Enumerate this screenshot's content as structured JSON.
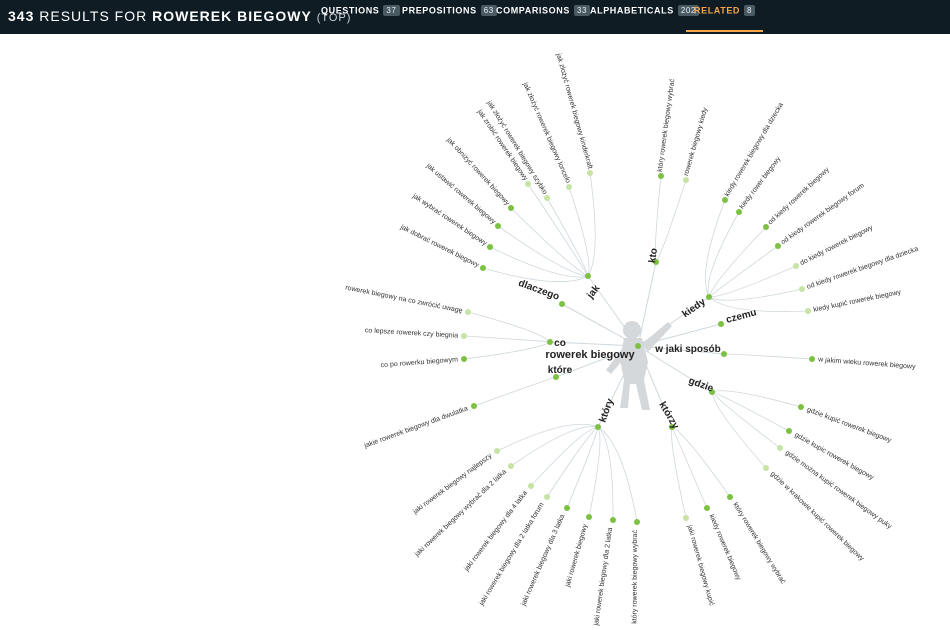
{
  "header": {
    "count": "343",
    "results_for": "RESULTS FOR",
    "keyword": "ROWEREK BIEGOWY",
    "mode": "(TOP)"
  },
  "tabs": [
    {
      "label": "QUESTIONS",
      "badge": "37",
      "active": false
    },
    {
      "label": "PREPOSITIONS",
      "badge": "63",
      "active": false
    },
    {
      "label": "COMPARISONS",
      "badge": "33",
      "active": false
    },
    {
      "label": "ALPHABETICALS",
      "badge": "202",
      "active": false
    },
    {
      "label": "RELATED",
      "badge": "8",
      "active": true
    }
  ],
  "colors": {
    "node_dark": "#7cc143",
    "node_light": "#c5e4a6",
    "link": "#cfd8dd",
    "header_bg": "#0f1c24",
    "active_tab": "#f3a64a"
  },
  "wheel": {
    "center_label": "rowerek biegowy",
    "center_icon": "person-silhouette-icon",
    "branches": [
      {
        "label": "jak",
        "leaves": [
          {
            "label": "jak dobrać rowerek biegowy",
            "shade": "dark"
          },
          {
            "label": "jak wybrać rowerek biegowy",
            "shade": "dark"
          },
          {
            "label": "jak ustawić rowerek biegowy",
            "shade": "dark"
          },
          {
            "label": "jak obniżyć rowerek biegowy",
            "shade": "dark"
          },
          {
            "label": "jak zrobić rowerek biegowy",
            "shade": "light"
          },
          {
            "label": "jak złożyć rowerek biegowy szybko",
            "shade": "light"
          },
          {
            "label": "jak złożyć rowerek biegowy loncelo",
            "shade": "light"
          },
          {
            "label": "jak złożyć rowerek biegowy kinderkraft",
            "shade": "light"
          }
        ]
      },
      {
        "label": "kto",
        "leaves": [
          {
            "label": "który rowerek biegowy wybrać",
            "shade": "dark"
          },
          {
            "label": "rowerek biegowy kiedy",
            "shade": "light"
          }
        ]
      },
      {
        "label": "kiedy",
        "leaves": [
          {
            "label": "kiedy rowerek biegowy dla dziecka",
            "shade": "dark"
          },
          {
            "label": "kiedy rower biegowy",
            "shade": "dark"
          },
          {
            "label": "od kiedy rowerek biegowy",
            "shade": "dark"
          },
          {
            "label": "od kiedy rowerek biegowy forum",
            "shade": "dark"
          },
          {
            "label": "do kiedy rowerek biegowy",
            "shade": "light"
          },
          {
            "label": "od kiedy rowerek biegowy dla dziecka",
            "shade": "light"
          },
          {
            "label": "kiedy kupić rowerek biegowy",
            "shade": "light"
          }
        ]
      },
      {
        "label": "czemu",
        "leaves": []
      },
      {
        "label": "w jaki sposób",
        "leaves": [
          {
            "label": "w jakim wieku rowerek biegowy",
            "shade": "dark"
          }
        ]
      },
      {
        "label": "gdzie",
        "leaves": [
          {
            "label": "gdzie kupić rowerek biegowy",
            "shade": "dark"
          },
          {
            "label": "gdzie kupic rowerek biegowy",
            "shade": "dark"
          },
          {
            "label": "gdzie można kupić rowerek biegowy puky",
            "shade": "light"
          },
          {
            "label": "gdzie w krakowie kupić rowerek biegowy",
            "shade": "light"
          }
        ]
      },
      {
        "label": "którzy",
        "leaves": [
          {
            "label": "który rowerek biegowy wybrać",
            "shade": "dark"
          },
          {
            "label": "kiedy rowerek biegowy",
            "shade": "dark"
          },
          {
            "label": "jaki rowerek biegowy kupić",
            "shade": "light"
          }
        ]
      },
      {
        "label": "który",
        "leaves": [
          {
            "label": "który rowerek biegowy wybrać",
            "shade": "dark"
          },
          {
            "label": "jaki rowerek biegowy dla 2 latka",
            "shade": "dark"
          },
          {
            "label": "jaki rowerek biegowy",
            "shade": "dark"
          },
          {
            "label": "jaki rowerek biegowy dla 3 latka",
            "shade": "dark"
          },
          {
            "label": "jaki rowerek biegowy dla 2 latka forum",
            "shade": "light"
          },
          {
            "label": "jaki rowerek biegowy dla 4 latka",
            "shade": "light"
          },
          {
            "label": "jaki rowerek biegowy wybrać dla 2 latka",
            "shade": "light"
          },
          {
            "label": "jaki rowerek biegowy najlepszy",
            "shade": "light"
          }
        ]
      },
      {
        "label": "które",
        "leaves": [
          {
            "label": "jakie rowerek biegowy dla dwulatka",
            "shade": "dark"
          }
        ]
      },
      {
        "label": "co",
        "leaves": [
          {
            "label": "co po rowerku biegowym",
            "shade": "dark"
          },
          {
            "label": "co lepsze rowerek czy biegnia",
            "shade": "light"
          },
          {
            "label": "rowerek biegowy na co zwrócić uwagę",
            "shade": "light"
          }
        ]
      },
      {
        "label": "dlaczego",
        "leaves": []
      }
    ]
  }
}
